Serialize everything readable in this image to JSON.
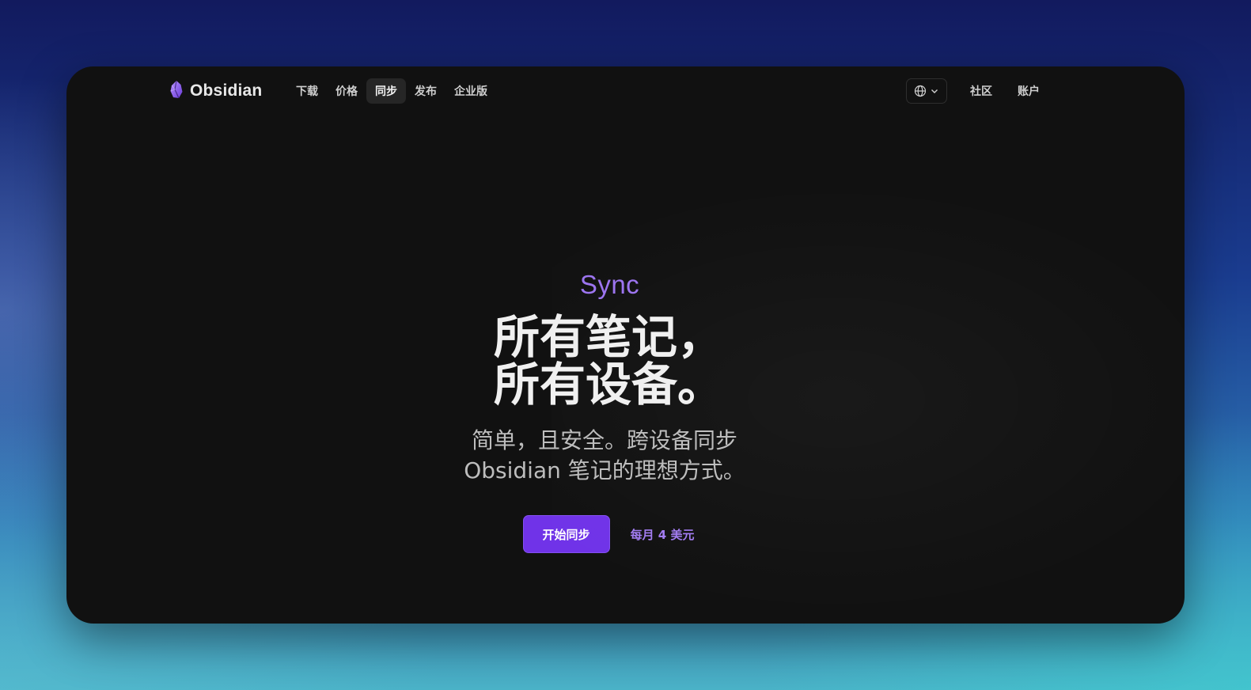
{
  "brand": {
    "name": "Obsidian",
    "accent": "#7033e8"
  },
  "nav": {
    "items": [
      {
        "label": "下载"
      },
      {
        "label": "价格"
      },
      {
        "label": "同步",
        "active": true
      },
      {
        "label": "发布"
      },
      {
        "label": "企业版"
      }
    ],
    "language_icon": "globe-icon",
    "right_items": [
      {
        "label": "社区"
      },
      {
        "label": "账户"
      }
    ]
  },
  "hero": {
    "kicker": "Sync",
    "headline_line1": "所有笔记，",
    "headline_line2": "所有设备。",
    "subhead": "简单，且安全。跨设备同步 Obsidian 笔记的理想方式。",
    "cta_primary": "开始同步",
    "cta_secondary": "每月 4 美元"
  }
}
